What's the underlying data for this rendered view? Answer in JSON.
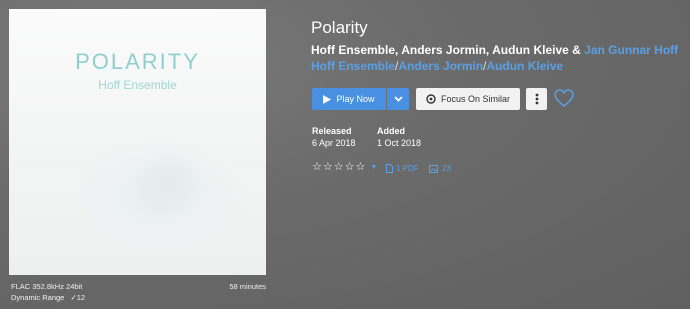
{
  "album": {
    "title": "Polarity",
    "cover_title": "POLARITY",
    "cover_subtitle": "Hoff Ensemble",
    "artists_plain": "Hoff Ensemble, Anders Jormin, Audun Kleive & ",
    "artists_link_line1": "Jan Gunnar Hoff",
    "artist_links": [
      "Hoff Ensemble",
      "Anders Jormin",
      "Audun Kleive"
    ],
    "separator": "/"
  },
  "format": {
    "quality": "FLAC 352.8kHz 24bit",
    "duration": "58 minutes",
    "dynamic_range_label": "Dynamic Range",
    "dynamic_range_value": "12"
  },
  "actions": {
    "play_label": "Play Now",
    "similar_label": "Focus On Similar"
  },
  "info": {
    "released_label": "Released",
    "released_value": "6 Apr 2018",
    "added_label": "Added",
    "added_value": "1 Oct 2018"
  },
  "extras": {
    "rating": 0,
    "pdf_label": "1 PDF",
    "images_count": "23"
  },
  "colors": {
    "accent": "#4a90e2",
    "link": "#5aa0e6",
    "background": "#6b6b6b"
  }
}
